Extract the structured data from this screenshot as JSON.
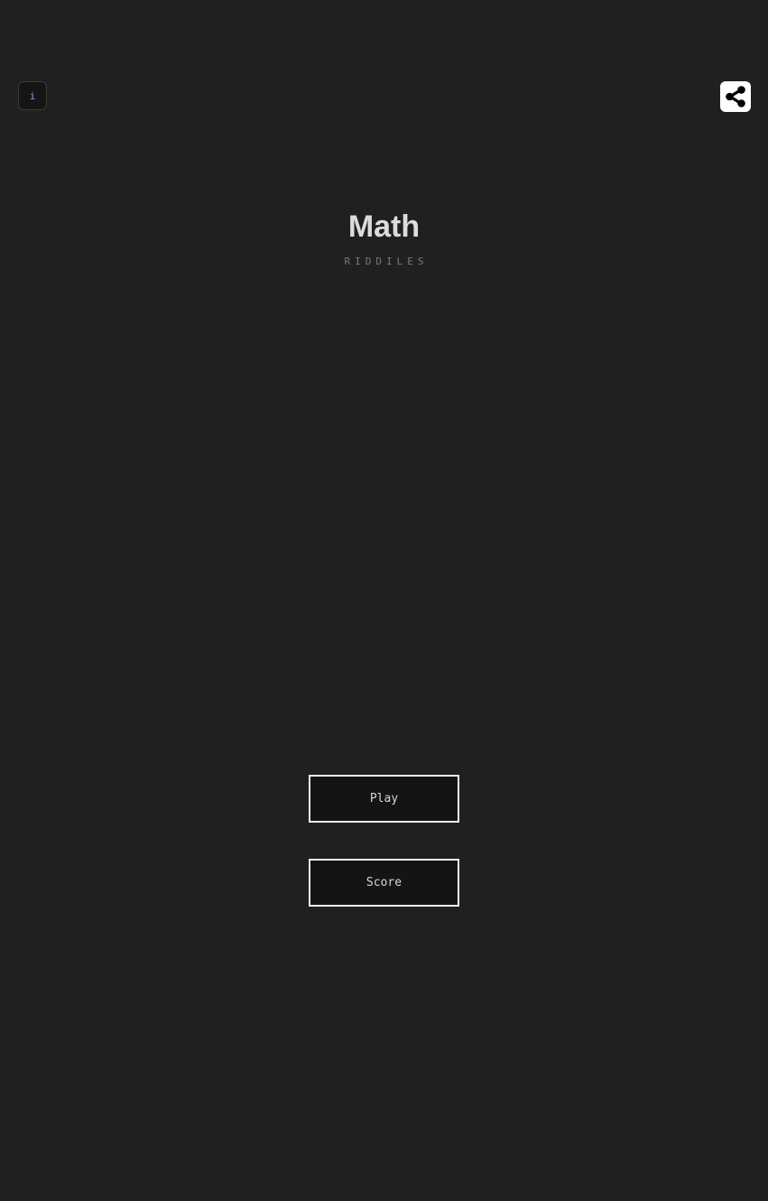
{
  "header": {
    "info_label": "i",
    "info_icon": "info-icon",
    "share_icon": "share-icon"
  },
  "title": {
    "main": "Math",
    "subtitle": "RIDDILES"
  },
  "menu": {
    "play_label": "Play",
    "score_label": "Score"
  },
  "colors": {
    "background": "#202020",
    "title": "#dcdcdc",
    "subtitle": "#7a7a7a",
    "info_glyph": "#9b8fe0",
    "button_fill": "#141414",
    "button_border": "#eeeeee",
    "share_fill": "#ffffff",
    "share_glyph": "#000000"
  }
}
